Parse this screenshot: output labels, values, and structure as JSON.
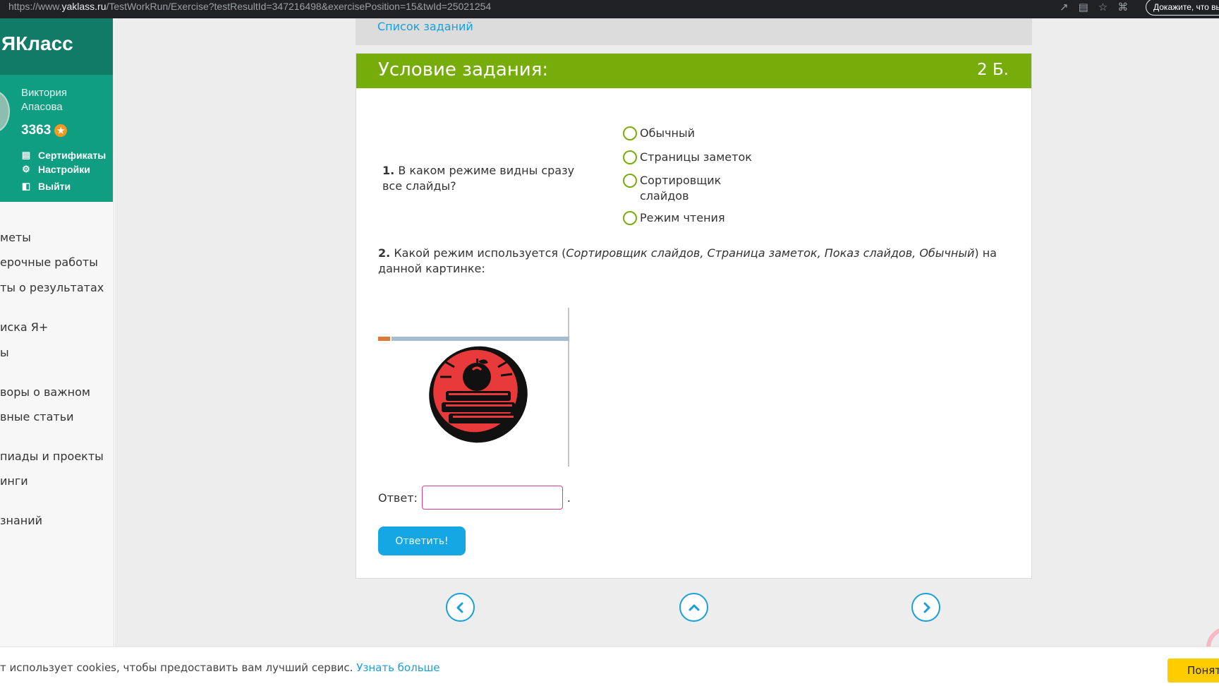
{
  "browser": {
    "url_prefix": "https://www.",
    "url_domain": "yaklass.ru",
    "url_path": "/TestWorkRun/Exercise?testResultId=347216498&exercisePosition=15&twId=25021254",
    "extension_button": "Докажите, что вы"
  },
  "brand": {
    "name": "ЯКласс"
  },
  "profile": {
    "name_line1": "Виктория",
    "name_line2": "Апасова",
    "points": "3363",
    "links": {
      "certificates": "Сертификаты",
      "settings": "Настройки",
      "logout": "Выйти"
    }
  },
  "menu": {
    "items": [
      "меты",
      "ерочные работы",
      "ты о результатах",
      "иска Я+",
      "ы",
      "воры о важном",
      "вные статьи",
      "пиады и проекты",
      "инги",
      "знаний"
    ]
  },
  "main": {
    "task_list_link": "Список заданий",
    "card": {
      "title": "Условие задания:",
      "score": "2 Б.",
      "q1": {
        "number": "1.",
        "text": "В каком режиме видны сразу все слайды?",
        "options": [
          "Обычный",
          "Страницы заметок",
          "Сортировщик слайдов",
          "Режим чтения"
        ]
      },
      "q2": {
        "number": "2.",
        "text_before": "Какой режим используется (",
        "text_italic": "Сортировщик слайдов, Страница заметок, Показ слайдов, Обычный",
        "text_after": ") на данной картинке:"
      },
      "answer_label": "Ответ:",
      "answer_value": "",
      "answer_suffix": ".",
      "submit_label": "Ответить!"
    }
  },
  "cookie": {
    "text": "т использует cookies, чтобы предоставить вам лучший сервис.",
    "link": "Узнать больше",
    "button": "Понятно"
  },
  "colors": {
    "brand_dark": "#127b67",
    "brand_teal": "#0f9e82",
    "header_green": "#77ad0a",
    "link_blue": "#1a9fd9",
    "button_blue": "#14a7e3",
    "input_border": "#d63f8f",
    "cookie_button": "#ffcc00"
  },
  "icons": [
    "certificate-icon",
    "gear-icon",
    "logout-icon",
    "star-icon",
    "chevron-left-icon",
    "chevron-up-icon",
    "chevron-right-icon"
  ]
}
